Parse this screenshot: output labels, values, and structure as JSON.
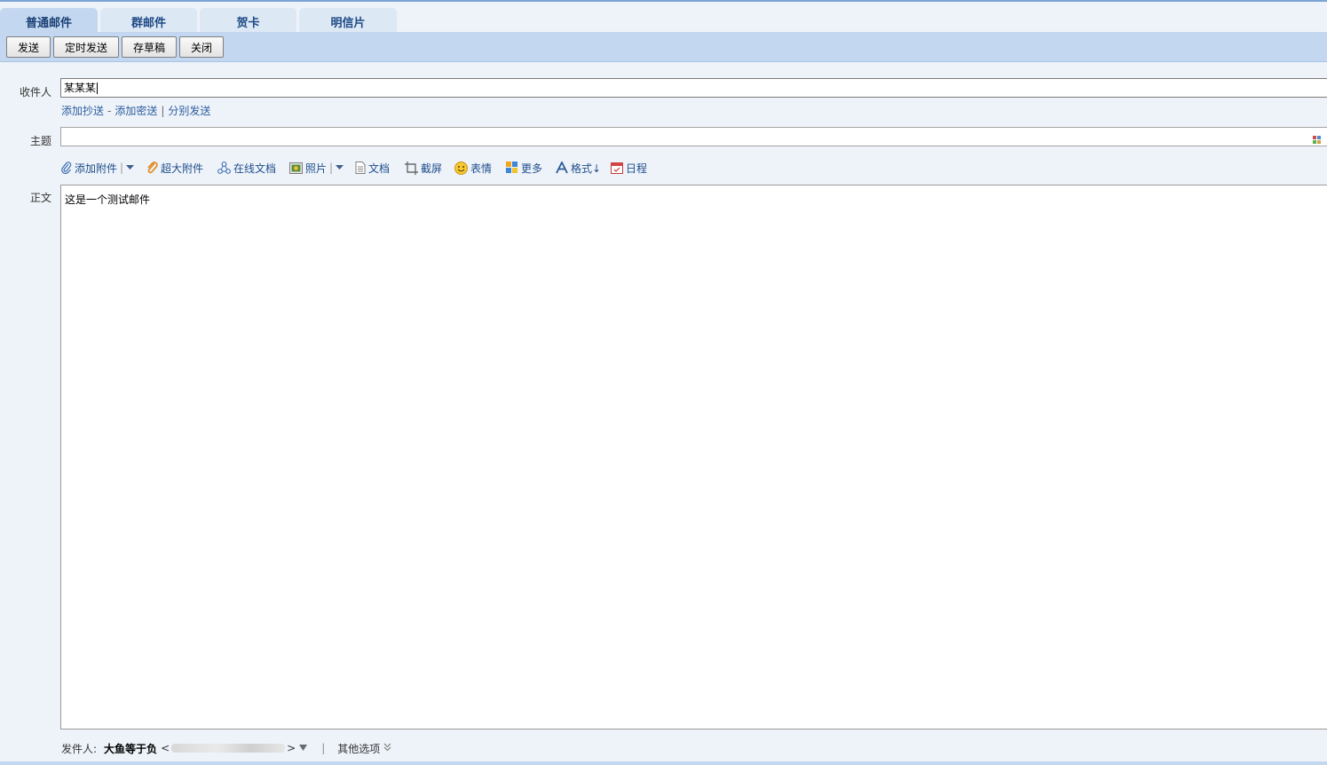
{
  "tabs": [
    {
      "label": "普通邮件",
      "active": true
    },
    {
      "label": "群邮件",
      "active": false
    },
    {
      "label": "贺卡",
      "active": false
    },
    {
      "label": "明信片",
      "active": false
    }
  ],
  "toolbar": {
    "send": "发送",
    "schedule_send": "定时发送",
    "save_draft": "存草稿",
    "close": "关闭"
  },
  "recipient": {
    "label": "收件人",
    "value": "某某某",
    "add_cc": "添加抄送",
    "dash": "-",
    "add_bcc": "添加密送",
    "pipe": "|",
    "separate_send": "分别发送"
  },
  "subject": {
    "label": "主题",
    "value": ""
  },
  "attach_toolbar": {
    "add_attachment": "添加附件",
    "large_attachment": "超大附件",
    "online_doc": "在线文档",
    "photo": "照片",
    "document": "文档",
    "screenshot": "截屏",
    "emoji": "表情",
    "more": "更多",
    "format": "格式↓",
    "schedule": "日程"
  },
  "body": {
    "label": "正文",
    "text": "这是一个测试邮件"
  },
  "footer": {
    "sender_label": "发件人:",
    "sender_name": "大鱼等于负",
    "lt": "<",
    "gt": ">",
    "pipe": "|",
    "other_options": "其他选项"
  },
  "colors": {
    "accent": "#c3d8f0",
    "link": "#2b5c9e",
    "background": "#eef3f9"
  }
}
